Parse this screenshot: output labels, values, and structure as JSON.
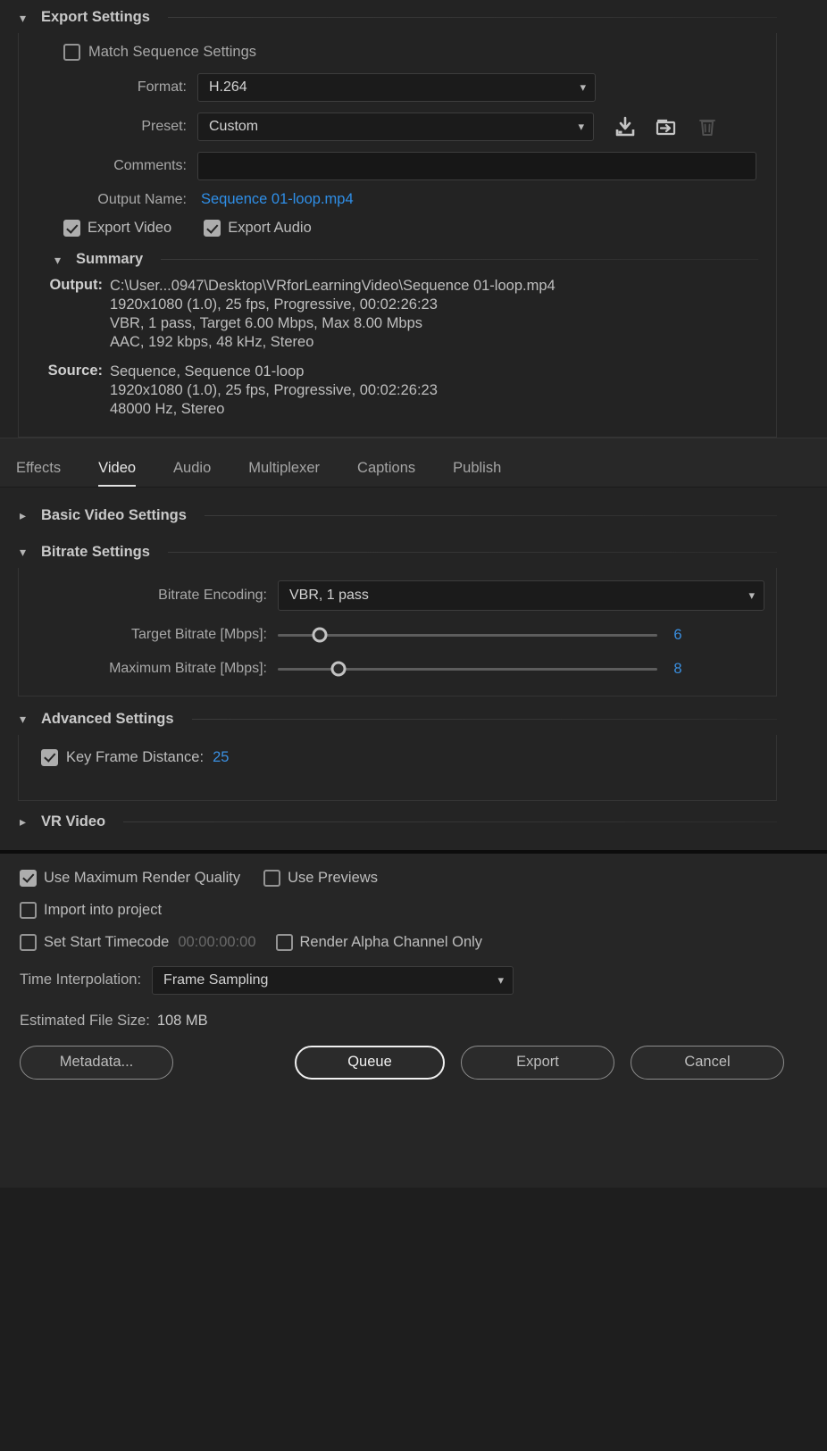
{
  "export_settings": {
    "title": "Export Settings",
    "match_sequence": {
      "label": "Match Sequence Settings",
      "checked": false
    },
    "format": {
      "label": "Format:",
      "value": "H.264"
    },
    "preset": {
      "label": "Preset:",
      "value": "Custom"
    },
    "preset_actions": [
      "save-preset-icon",
      "import-preset-icon",
      "delete-preset-icon"
    ],
    "comments": {
      "label": "Comments:",
      "value": "",
      "placeholder": ""
    },
    "output_name": {
      "label": "Output Name:",
      "value": "Sequence 01-loop.mp4"
    },
    "export_video": {
      "label": "Export Video",
      "checked": true
    },
    "export_audio": {
      "label": "Export Audio",
      "checked": true
    }
  },
  "summary": {
    "title": "Summary",
    "output_key": "Output:",
    "output_lines": [
      "C:\\User...0947\\Desktop\\VRforLearningVideo\\Sequence 01-loop.mp4",
      "1920x1080 (1.0), 25 fps, Progressive, 00:02:26:23",
      "VBR, 1 pass, Target 6.00 Mbps, Max 8.00 Mbps",
      "AAC, 192 kbps, 48 kHz, Stereo"
    ],
    "source_key": "Source:",
    "source_lines": [
      "Sequence, Sequence 01-loop",
      "1920x1080 (1.0), 25 fps, Progressive, 00:02:26:23",
      "48000 Hz, Stereo"
    ]
  },
  "tabs": [
    {
      "label": "Effects",
      "active": false
    },
    {
      "label": "Video",
      "active": true
    },
    {
      "label": "Audio",
      "active": false
    },
    {
      "label": "Multiplexer",
      "active": false
    },
    {
      "label": "Captions",
      "active": false
    },
    {
      "label": "Publish",
      "active": false
    }
  ],
  "video_tab": {
    "basic_video_settings": {
      "title": "Basic Video Settings",
      "expanded": false
    },
    "bitrate_settings": {
      "title": "Bitrate Settings",
      "expanded": true,
      "bitrate_encoding": {
        "label": "Bitrate Encoding:",
        "value": "VBR, 1 pass"
      },
      "target_bitrate": {
        "label": "Target Bitrate [Mbps]:",
        "value": "6",
        "percent": 11
      },
      "maximum_bitrate": {
        "label": "Maximum Bitrate [Mbps]:",
        "value": "8",
        "percent": 16
      }
    },
    "advanced_settings": {
      "title": "Advanced Settings",
      "expanded": true,
      "key_frame_distance": {
        "label": "Key Frame Distance:",
        "value": "25",
        "checked": true
      }
    },
    "vr_video": {
      "title": "VR Video",
      "expanded": false
    }
  },
  "bottom": {
    "use_max_render_quality": {
      "label": "Use Maximum Render Quality",
      "checked": true
    },
    "use_previews": {
      "label": "Use Previews",
      "checked": false
    },
    "import_into_project": {
      "label": "Import into project",
      "checked": false
    },
    "set_start_timecode": {
      "label": "Set Start Timecode",
      "checked": false,
      "timecode": "00:00:00:00"
    },
    "render_alpha_only": {
      "label": "Render Alpha Channel Only",
      "checked": false
    },
    "time_interpolation": {
      "label": "Time Interpolation:",
      "value": "Frame Sampling"
    },
    "estimated_file_size": {
      "label": "Estimated File Size:",
      "value": "108 MB"
    },
    "buttons": {
      "metadata": "Metadata...",
      "queue": "Queue",
      "export": "Export",
      "cancel": "Cancel"
    }
  },
  "colors": {
    "accent_blue": "#2f8fe8",
    "panel_bg": "#232323",
    "bottom_bg": "#262626"
  }
}
